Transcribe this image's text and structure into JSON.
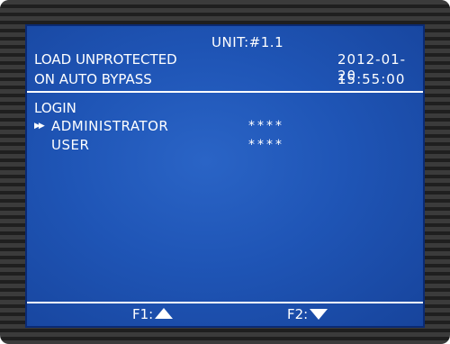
{
  "header": {
    "unit": "UNIT:#1.1",
    "alarm_line1": "LOAD UNPROTECTED",
    "alarm_line2": "ON AUTO BYPASS",
    "date": "2012-01-20",
    "time": "15:55:00"
  },
  "menu": {
    "title": "LOGIN",
    "cursor_glyph": "▶▶",
    "items": [
      {
        "label": "ADMINISTRATOR",
        "password": "****",
        "selected": true
      },
      {
        "label": "USER",
        "password": "****",
        "selected": false
      }
    ]
  },
  "footer": {
    "f1_label": "F1:",
    "f1_icon": "up-triangle-icon",
    "f2_label": "F2:",
    "f2_icon": "down-triangle-icon"
  },
  "colors": {
    "screen_blue": "#1f55b6",
    "text": "#ffffff",
    "bezel": "#2b2b2b"
  }
}
